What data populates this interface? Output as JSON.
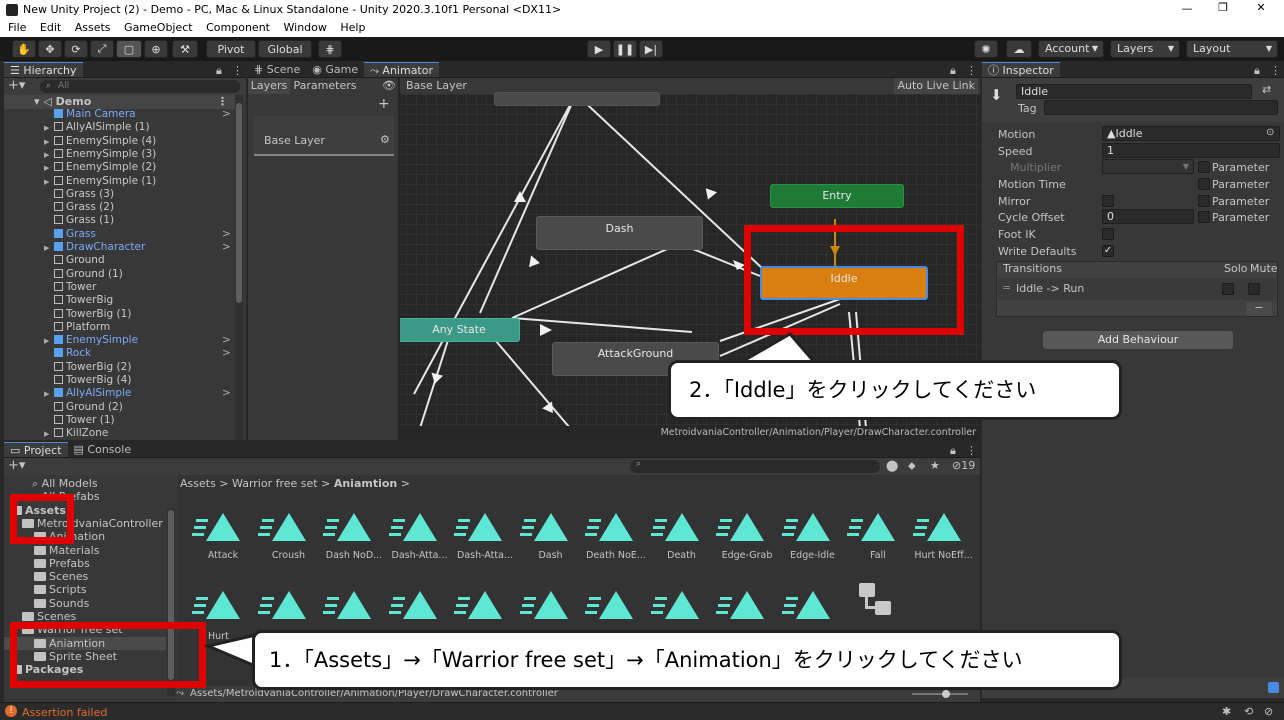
{
  "window": {
    "title": "New Unity Project (2) - Demo - PC, Mac & Linux Standalone - Unity 2020.3.10f1 Personal <DX11>"
  },
  "menu": [
    "File",
    "Edit",
    "Assets",
    "GameObject",
    "Component",
    "Window",
    "Help"
  ],
  "toolbar": {
    "pivot": "Pivot",
    "global": "Global",
    "account": "Account",
    "layers": "Layers",
    "layout": "Layout"
  },
  "hierarchy": {
    "tab": "Hierarchy",
    "search_placeholder": "All",
    "scene": "Demo",
    "items": [
      {
        "label": "Main Camera",
        "blue": true,
        "arrow": false,
        "chev": true
      },
      {
        "label": "AllyAISimple (1)",
        "blue": false,
        "arrow": true,
        "chev": false
      },
      {
        "label": "EnemySimple (4)",
        "blue": false,
        "arrow": true,
        "chev": false
      },
      {
        "label": "EnemySimple (3)",
        "blue": false,
        "arrow": true,
        "chev": false
      },
      {
        "label": "EnemySimple (2)",
        "blue": false,
        "arrow": true,
        "chev": false
      },
      {
        "label": "EnemySimple (1)",
        "blue": false,
        "arrow": true,
        "chev": false
      },
      {
        "label": "Grass (3)",
        "blue": false,
        "arrow": false,
        "chev": false
      },
      {
        "label": "Grass (2)",
        "blue": false,
        "arrow": false,
        "chev": false
      },
      {
        "label": "Grass (1)",
        "blue": false,
        "arrow": false,
        "chev": false
      },
      {
        "label": "Grass",
        "blue": true,
        "arrow": false,
        "chev": true
      },
      {
        "label": "DrawCharacter",
        "blue": true,
        "arrow": true,
        "chev": true
      },
      {
        "label": "Ground",
        "blue": false,
        "arrow": false,
        "chev": false
      },
      {
        "label": "Ground (1)",
        "blue": false,
        "arrow": false,
        "chev": false
      },
      {
        "label": "Tower",
        "blue": false,
        "arrow": false,
        "chev": false
      },
      {
        "label": "TowerBig",
        "blue": false,
        "arrow": false,
        "chev": false
      },
      {
        "label": "TowerBig (1)",
        "blue": false,
        "arrow": false,
        "chev": false
      },
      {
        "label": "Platform",
        "blue": false,
        "arrow": false,
        "chev": false
      },
      {
        "label": "EnemySimple",
        "blue": true,
        "arrow": true,
        "chev": true
      },
      {
        "label": "Rock",
        "blue": true,
        "arrow": false,
        "chev": true
      },
      {
        "label": "TowerBig (2)",
        "blue": false,
        "arrow": false,
        "chev": false
      },
      {
        "label": "TowerBig (4)",
        "blue": false,
        "arrow": false,
        "chev": false
      },
      {
        "label": "AllyAISimple",
        "blue": true,
        "arrow": true,
        "chev": true
      },
      {
        "label": "Ground (2)",
        "blue": false,
        "arrow": false,
        "chev": false
      },
      {
        "label": "Tower (1)",
        "blue": false,
        "arrow": false,
        "chev": false
      },
      {
        "label": "KillZone",
        "blue": false,
        "arrow": true,
        "chev": false
      }
    ]
  },
  "center_tabs": [
    "Scene",
    "Game",
    "Animator"
  ],
  "animator": {
    "layers_tab": "Layers",
    "parameters_tab": "Parameters",
    "breadcrumb": "Base Layer",
    "auto_live_link": "Auto Live Link",
    "layer_name": "Base Layer",
    "nodes": {
      "entry": "Entry",
      "iddle": "Iddle",
      "dash": "Dash",
      "any_state": "Any State",
      "attack_ground": "AttackGround"
    },
    "path": "MetroidvaniaController/Animation/Player/DrawCharacter.controller"
  },
  "inspector": {
    "tab": "Inspector",
    "name": "Iddle",
    "tag_label": "Tag",
    "motion_label": "Motion",
    "motion_value": "Iddle",
    "speed_label": "Speed",
    "speed_value": "1",
    "multiplier_label": "Multiplier",
    "parameter": "Parameter",
    "motion_time_label": "Motion Time",
    "mirror_label": "Mirror",
    "cycle_offset_label": "Cycle Offset",
    "cycle_offset_value": "0",
    "foot_ik_label": "Foot IK",
    "write_defaults_label": "Write Defaults",
    "transitions_label": "Transitions",
    "solo": "Solo",
    "mute": "Mute",
    "transition_item": "Iddle -> Run",
    "minus": "−",
    "add_behaviour": "Add Behaviour"
  },
  "project": {
    "tab": "Project",
    "console_tab": "Console",
    "badge": "19",
    "breadcrumb": [
      "Assets",
      "Warrior free set",
      "Aniamtion"
    ],
    "tree": [
      {
        "label": "All Models",
        "indent": 0,
        "type": "search"
      },
      {
        "label": "All Prefabs",
        "indent": 0,
        "type": "search"
      },
      {
        "label": "Assets",
        "indent": 0,
        "type": "folder",
        "bold": true
      },
      {
        "label": "MetroidvaniaController",
        "indent": 1,
        "type": "folder"
      },
      {
        "label": "Animation",
        "indent": 2,
        "type": "folder"
      },
      {
        "label": "Materials",
        "indent": 2,
        "type": "folder"
      },
      {
        "label": "Prefabs",
        "indent": 2,
        "type": "folder"
      },
      {
        "label": "Scenes",
        "indent": 2,
        "type": "folder"
      },
      {
        "label": "Scripts",
        "indent": 2,
        "type": "folder"
      },
      {
        "label": "Sounds",
        "indent": 2,
        "type": "folder"
      },
      {
        "label": "Scenes",
        "indent": 1,
        "type": "folder"
      },
      {
        "label": "Warrior free set",
        "indent": 1,
        "type": "folder"
      },
      {
        "label": "Aniamtion",
        "indent": 2,
        "type": "folder",
        "selected": true
      },
      {
        "label": "Sprite Sheet",
        "indent": 2,
        "type": "folder"
      },
      {
        "label": "Packages",
        "indent": 0,
        "type": "folder",
        "bold": true
      }
    ],
    "assets_row1": [
      "Attack",
      "Croush",
      "Dash NoD...",
      "Dash-Atta...",
      "Dash-Atta...",
      "Dash",
      "Death NoE...",
      "Death",
      "Edge-Grab",
      "Edge-Idle",
      "Fall",
      "Hurt NoEff..."
    ],
    "assets_row2_label": "Hurt",
    "status_path": "Assets/MetroidvaniaController/Animation/Player/DrawCharacter.controller"
  },
  "status": {
    "message": "Assertion failed"
  },
  "annotations": {
    "callout1": "1．「Assets」→「Warrior free set」→「Animation」をクリックしてください",
    "callout2": "2．「Iddle」をクリックしてください"
  },
  "colors": {
    "accent_blue": "#4a8ae4",
    "entry_green": "#1f7a35",
    "iddle_orange": "#d87f10",
    "any_state_teal": "#3a9a87",
    "red": "#e00000",
    "asset_teal": "#5ee8d4"
  }
}
